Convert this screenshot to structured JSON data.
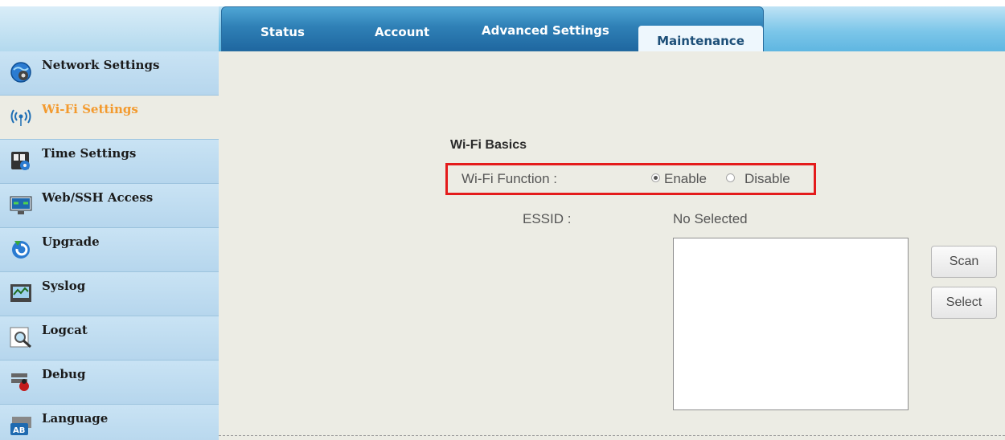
{
  "tabs": {
    "status": "Status",
    "account": "Account",
    "advanced": "Advanced Settings",
    "maintenance": "Maintenance"
  },
  "sidebar": {
    "items": [
      {
        "label": "Network Settings",
        "icon": "globe-gear-icon"
      },
      {
        "label": "Wi-Fi Settings",
        "icon": "wifi-signal-icon",
        "active": true
      },
      {
        "label": "Time Settings",
        "icon": "clock-gear-icon"
      },
      {
        "label": "Web/SSH Access",
        "icon": "monitor-network-icon"
      },
      {
        "label": "Upgrade",
        "icon": "upgrade-arrow-icon"
      },
      {
        "label": "Syslog",
        "icon": "syslog-chart-icon"
      },
      {
        "label": "Logcat",
        "icon": "magnifier-icon"
      },
      {
        "label": "Debug",
        "icon": "bug-icon"
      },
      {
        "label": "Language",
        "icon": "language-ab-icon"
      }
    ]
  },
  "wifi": {
    "section_title": "Wi-Fi Basics",
    "function_label": "Wi-Fi Function :",
    "enable_label": "Enable",
    "disable_label": "Disable",
    "selected_option": "Enable",
    "essid_label": "ESSID :",
    "essid_value": "No Selected",
    "scan_button": "Scan",
    "select_button": "Select"
  },
  "colors": {
    "highlight_box": "#e41b1b",
    "active_sidebar_text": "#f39a2e",
    "tab_bar": "#2f80b6"
  }
}
